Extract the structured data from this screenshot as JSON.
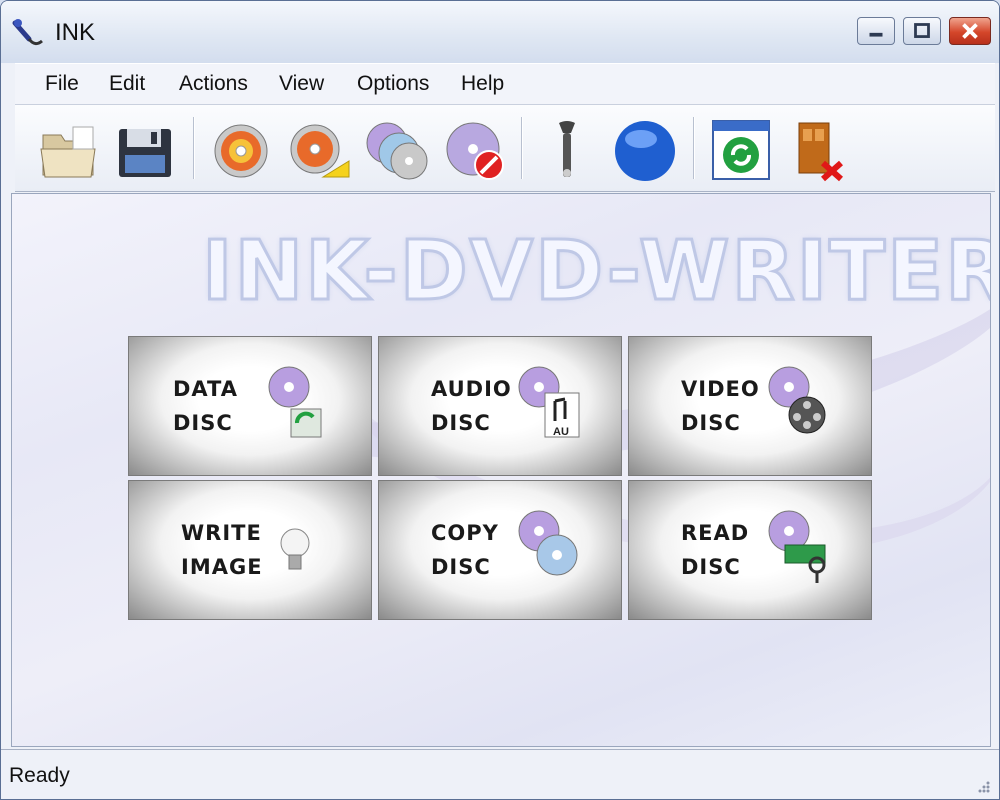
{
  "window": {
    "title": "INK"
  },
  "menu": [
    "File",
    "Edit",
    "Actions",
    "View",
    "Options",
    "Help"
  ],
  "toolbar": [
    "open-folder-icon",
    "save-floppy-icon",
    "burn-disc-icon",
    "disc-export-icon",
    "copy-discs-icon",
    "erase-disc-icon",
    "settings-wrench-icon",
    "blue-sphere-icon",
    "update-refresh-icon",
    "exit-door-icon"
  ],
  "banner": "INK-DVD-WRITER",
  "tiles": [
    {
      "line1": "DATA",
      "line2": "DISC",
      "icon": "data-disc-icon"
    },
    {
      "line1": "AUDIO",
      "line2": "DISC",
      "icon": "audio-disc-icon",
      "badge": "AU"
    },
    {
      "line1": "VIDEO",
      "line2": "DISC",
      "icon": "video-disc-icon"
    },
    {
      "line1": "WRITE",
      "line2": "IMAGE",
      "icon": "lightbulb-icon"
    },
    {
      "line1": "COPY",
      "line2": "DISC",
      "icon": "copy-disc-icon"
    },
    {
      "line1": "READ",
      "line2": "DISC",
      "icon": "read-disc-icon"
    }
  ],
  "status": {
    "text": "Ready"
  }
}
